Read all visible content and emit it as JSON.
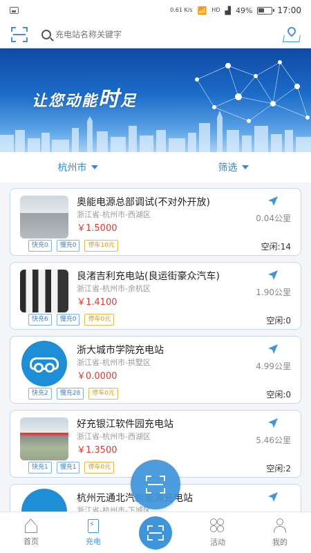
{
  "status_bar": {
    "signal_text": "0.61 K/s",
    "network": "HD",
    "battery": "49%",
    "time": "17:00"
  },
  "search": {
    "placeholder": "充电站名称关键字"
  },
  "banner": {
    "slogan_small": "让您动能",
    "slogan_big": "时",
    "slogan_end": "足"
  },
  "filters": {
    "city": "杭州市",
    "filter": "筛选"
  },
  "stations": [
    {
      "name": "奥能电源总部调试(不对外开放)",
      "address": "浙江省-杭州市-西湖区",
      "price": "￥1.5000",
      "distance": "0.04公里",
      "idle": "空闲:14",
      "fast": "快充0",
      "slow": "慢充0",
      "parking": "停车10元"
    },
    {
      "name": "良渚吉利充电站(良运街豪众汽车)",
      "address": "浙江省-杭州市-余杭区",
      "price": "￥1.4100",
      "distance": "1.90公里",
      "idle": "空闲:0",
      "fast": "快充6",
      "slow": "慢充0",
      "parking": "停车0元"
    },
    {
      "name": "浙大城市学院充电站",
      "address": "浙江省-杭州市-拱墅区",
      "price": "￥0.0000",
      "distance": "4.99公里",
      "idle": "空闲:0",
      "fast": "快充2",
      "slow": "慢充28",
      "parking": "停车0元"
    },
    {
      "name": "好充银江软件园充电站",
      "address": "浙江省-杭州市-西湖区",
      "price": "￥1.3500",
      "distance": "5.46公里",
      "idle": "空闲:2",
      "fast": "快充1",
      "slow": "慢充1",
      "parking": "停车0元"
    },
    {
      "name": "杭州元通北汽新能源充电站",
      "address": "浙江省-杭州市-下城区",
      "price": "",
      "distance": "",
      "idle": "",
      "fast": "",
      "slow": "",
      "parking": ""
    }
  ],
  "tabs": {
    "home": "首页",
    "charge": "充电",
    "activity": "活动",
    "me": "我的"
  },
  "colors": {
    "accent": "#3f95dc",
    "price": "#d63b2f",
    "card_border": "#c8d8ec"
  }
}
